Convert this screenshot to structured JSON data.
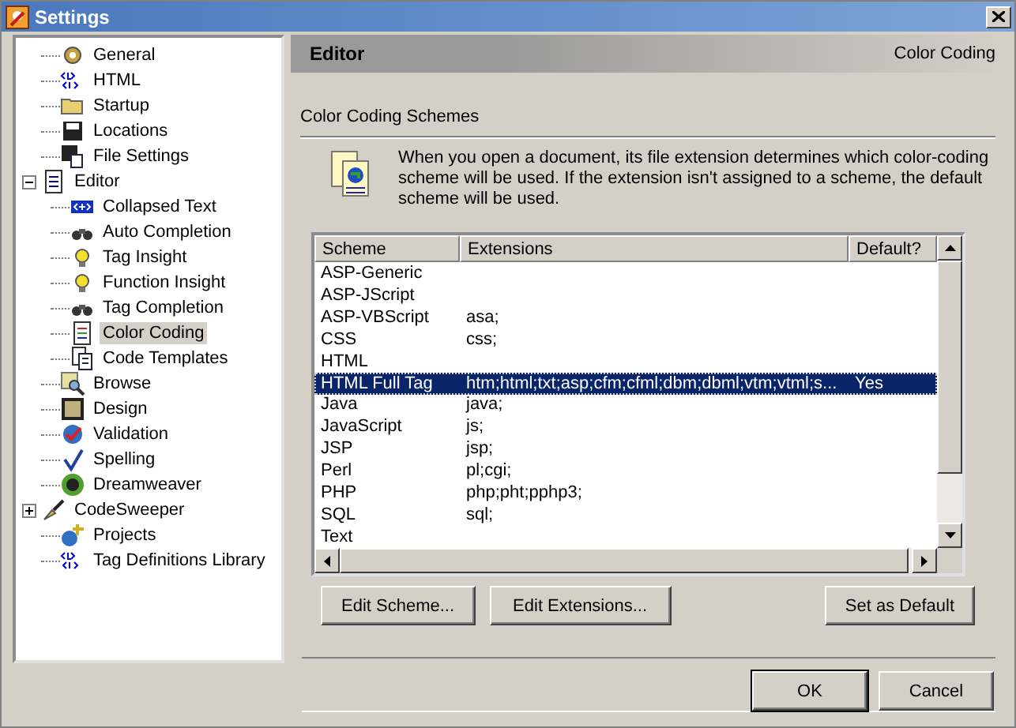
{
  "window": {
    "title": "Settings"
  },
  "tree": [
    {
      "label": "General",
      "selected": false
    },
    {
      "label": "HTML",
      "selected": false
    },
    {
      "label": "Startup",
      "selected": false
    },
    {
      "label": "Locations",
      "selected": false
    },
    {
      "label": "File Settings",
      "selected": false
    },
    {
      "label": "Editor",
      "selected": false,
      "expanded": true,
      "children": [
        {
          "label": "Collapsed Text",
          "selected": false
        },
        {
          "label": "Auto Completion",
          "selected": false
        },
        {
          "label": "Tag Insight",
          "selected": false
        },
        {
          "label": "Function Insight",
          "selected": false
        },
        {
          "label": "Tag Completion",
          "selected": false
        },
        {
          "label": "Color Coding",
          "selected": true
        },
        {
          "label": "Code Templates",
          "selected": false
        }
      ]
    },
    {
      "label": "Browse",
      "selected": false
    },
    {
      "label": "Design",
      "selected": false
    },
    {
      "label": "Validation",
      "selected": false
    },
    {
      "label": "Spelling",
      "selected": false
    },
    {
      "label": "Dreamweaver",
      "selected": false
    },
    {
      "label": "CodeSweeper",
      "selected": false,
      "expanded": false
    },
    {
      "label": "Projects",
      "selected": false
    },
    {
      "label": "Tag Definitions Library",
      "selected": false
    }
  ],
  "header": {
    "title": "Editor",
    "page": "Color Coding"
  },
  "section": {
    "title": "Color Coding Schemes",
    "description": "When you open a document, its file extension determines which color-coding scheme will be used.  If the extension isn't assigned to a scheme, the default scheme will be used."
  },
  "table": {
    "columns": [
      "Scheme",
      "Extensions",
      "Default?"
    ],
    "rows": [
      {
        "scheme": "ASP-Generic",
        "selected": false
      },
      {
        "scheme": "ASP-JScript",
        "selected": false
      },
      {
        "scheme": "ASP-VBScript",
        "extensions": "asa;",
        "selected": false
      },
      {
        "scheme": "CSS",
        "extensions": "css;",
        "selected": false
      },
      {
        "scheme": "HTML",
        "selected": false
      },
      {
        "scheme": "HTML Full Tag",
        "extensions": "htm;html;txt;asp;cfm;cfml;dbm;dbml;vtm;vtml;s...",
        "default": "Yes",
        "selected": true
      },
      {
        "scheme": "Java",
        "extensions": "java;",
        "selected": false
      },
      {
        "scheme": "JavaScript",
        "extensions": "js;",
        "selected": false
      },
      {
        "scheme": "JSP",
        "extensions": "jsp;",
        "selected": false
      },
      {
        "scheme": "Perl",
        "extensions": "pl;cgi;",
        "selected": false
      },
      {
        "scheme": "PHP",
        "extensions": "php;pht;pphp3;",
        "selected": false
      },
      {
        "scheme": "SQL",
        "extensions": "sql;",
        "selected": false
      },
      {
        "scheme": "Text",
        "selected": false
      }
    ]
  },
  "actions": [
    "Edit Scheme...",
    "Edit Extensions...",
    "Set as Default"
  ],
  "buttons": [
    {
      "label": "OK",
      "default": true
    },
    {
      "label": "Cancel",
      "default": false
    }
  ]
}
